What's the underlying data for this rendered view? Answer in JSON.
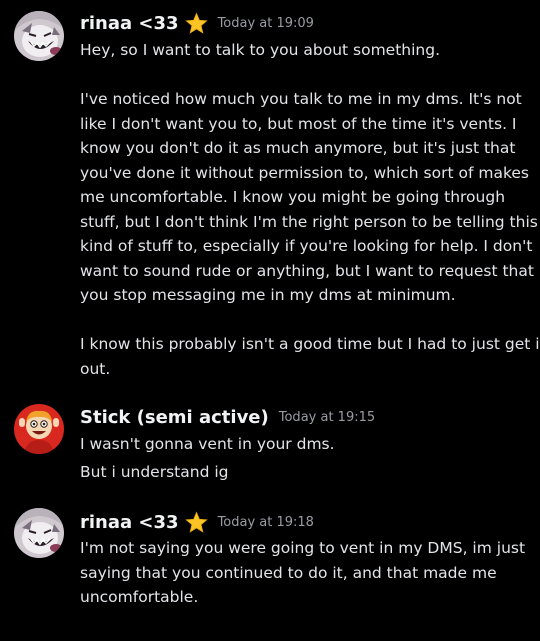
{
  "messages": [
    {
      "author": "rinaa <33",
      "badge_icon": "star-icon",
      "badge_color": "#fbc325",
      "timestamp": "Today at 19:09",
      "lines": [
        "Hey, so I want to talk to you about something.",
        "",
        "I've noticed how much you talk to me in my dms. It's not",
        "like I don't want you to, but most of the time it's vents. I",
        "know you don't do it as much anymore, but it's just that",
        "you've done it without permission to, which sort of makes",
        "me uncomfortable. I know you might be going through",
        "stuff, but I don't think I'm the right person to be telling this",
        "kind of stuff to, especially if you're looking for help. I don't",
        "want to sound rude or anything, but I want to request that",
        "you stop messaging me in my dms at minimum.",
        "",
        "I know this probably isn't a good time but I had to just get it",
        "out."
      ]
    },
    {
      "author": "Stick (semi active)",
      "timestamp": "Today at 19:15",
      "lines": [
        "I wasn't gonna vent in your dms.",
        "But i understand ig"
      ]
    },
    {
      "author": "rinaa <33",
      "badge_icon": "star-icon",
      "badge_color": "#fbc325",
      "timestamp": "Today at 19:18",
      "lines": [
        "I'm not saying you were going to vent in my DMS, im just",
        "saying that you continued to do it, and that made me",
        "uncomfortable."
      ]
    }
  ],
  "colors": {
    "background": "#000000",
    "username": "#f2f3f5",
    "timestamp": "#9a9ca3",
    "message_text": "#e3e4e8",
    "star": "#fbc325"
  }
}
